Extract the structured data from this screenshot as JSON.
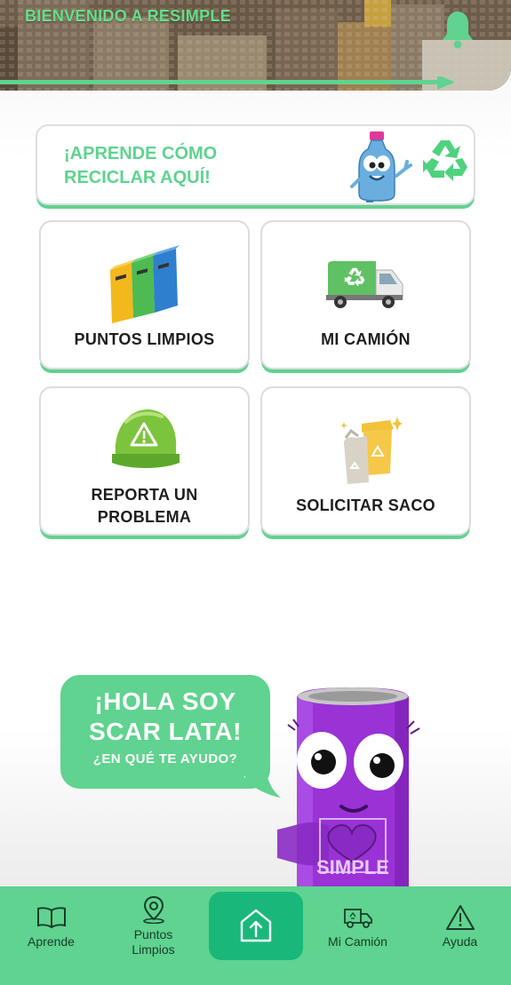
{
  "header": {
    "title": "BIENVENIDO A RESIMPLE",
    "notification_icon": "bell-icon"
  },
  "learn_banner": {
    "line1": "¡APRENDE CÓMO",
    "line2": "RECICLAR AQUÍ!",
    "mascot_icon": "bottle-mascot",
    "recycle_icon": "recycle-icon"
  },
  "cards": [
    {
      "label": "PUNTOS LIMPIOS",
      "icon": "recycling-bins-icon"
    },
    {
      "label": "MI CAMIÓN",
      "icon": "garbage-truck-icon"
    },
    {
      "label_line1": "REPORTA UN",
      "label_line2": "PROBLEMA",
      "icon": "warning-helmet-icon"
    },
    {
      "label": "SOLICITAR SACO",
      "icon": "sack-bin-icon"
    }
  ],
  "assistant": {
    "line1": "¡HOLA SOY",
    "line2": "SCAR LATA!",
    "line3": "¿EN QUÉ TE AYUDO?",
    "can_text": "SIMPLE"
  },
  "nav": {
    "items": [
      {
        "label": "Aprende",
        "icon": "book-icon"
      },
      {
        "label_line1": "Puntos",
        "label_line2": "Limpios",
        "icon": "map-pin-icon"
      },
      {
        "label": "",
        "icon": "home-upload-icon"
      },
      {
        "label": "Mi Camión",
        "icon": "truck-icon"
      },
      {
        "label": "Ayuda",
        "icon": "alert-icon"
      }
    ]
  },
  "colors": {
    "accent_green": "#5fd38f",
    "dark_green": "#19b87a",
    "text_dark": "#1e1e1e"
  }
}
